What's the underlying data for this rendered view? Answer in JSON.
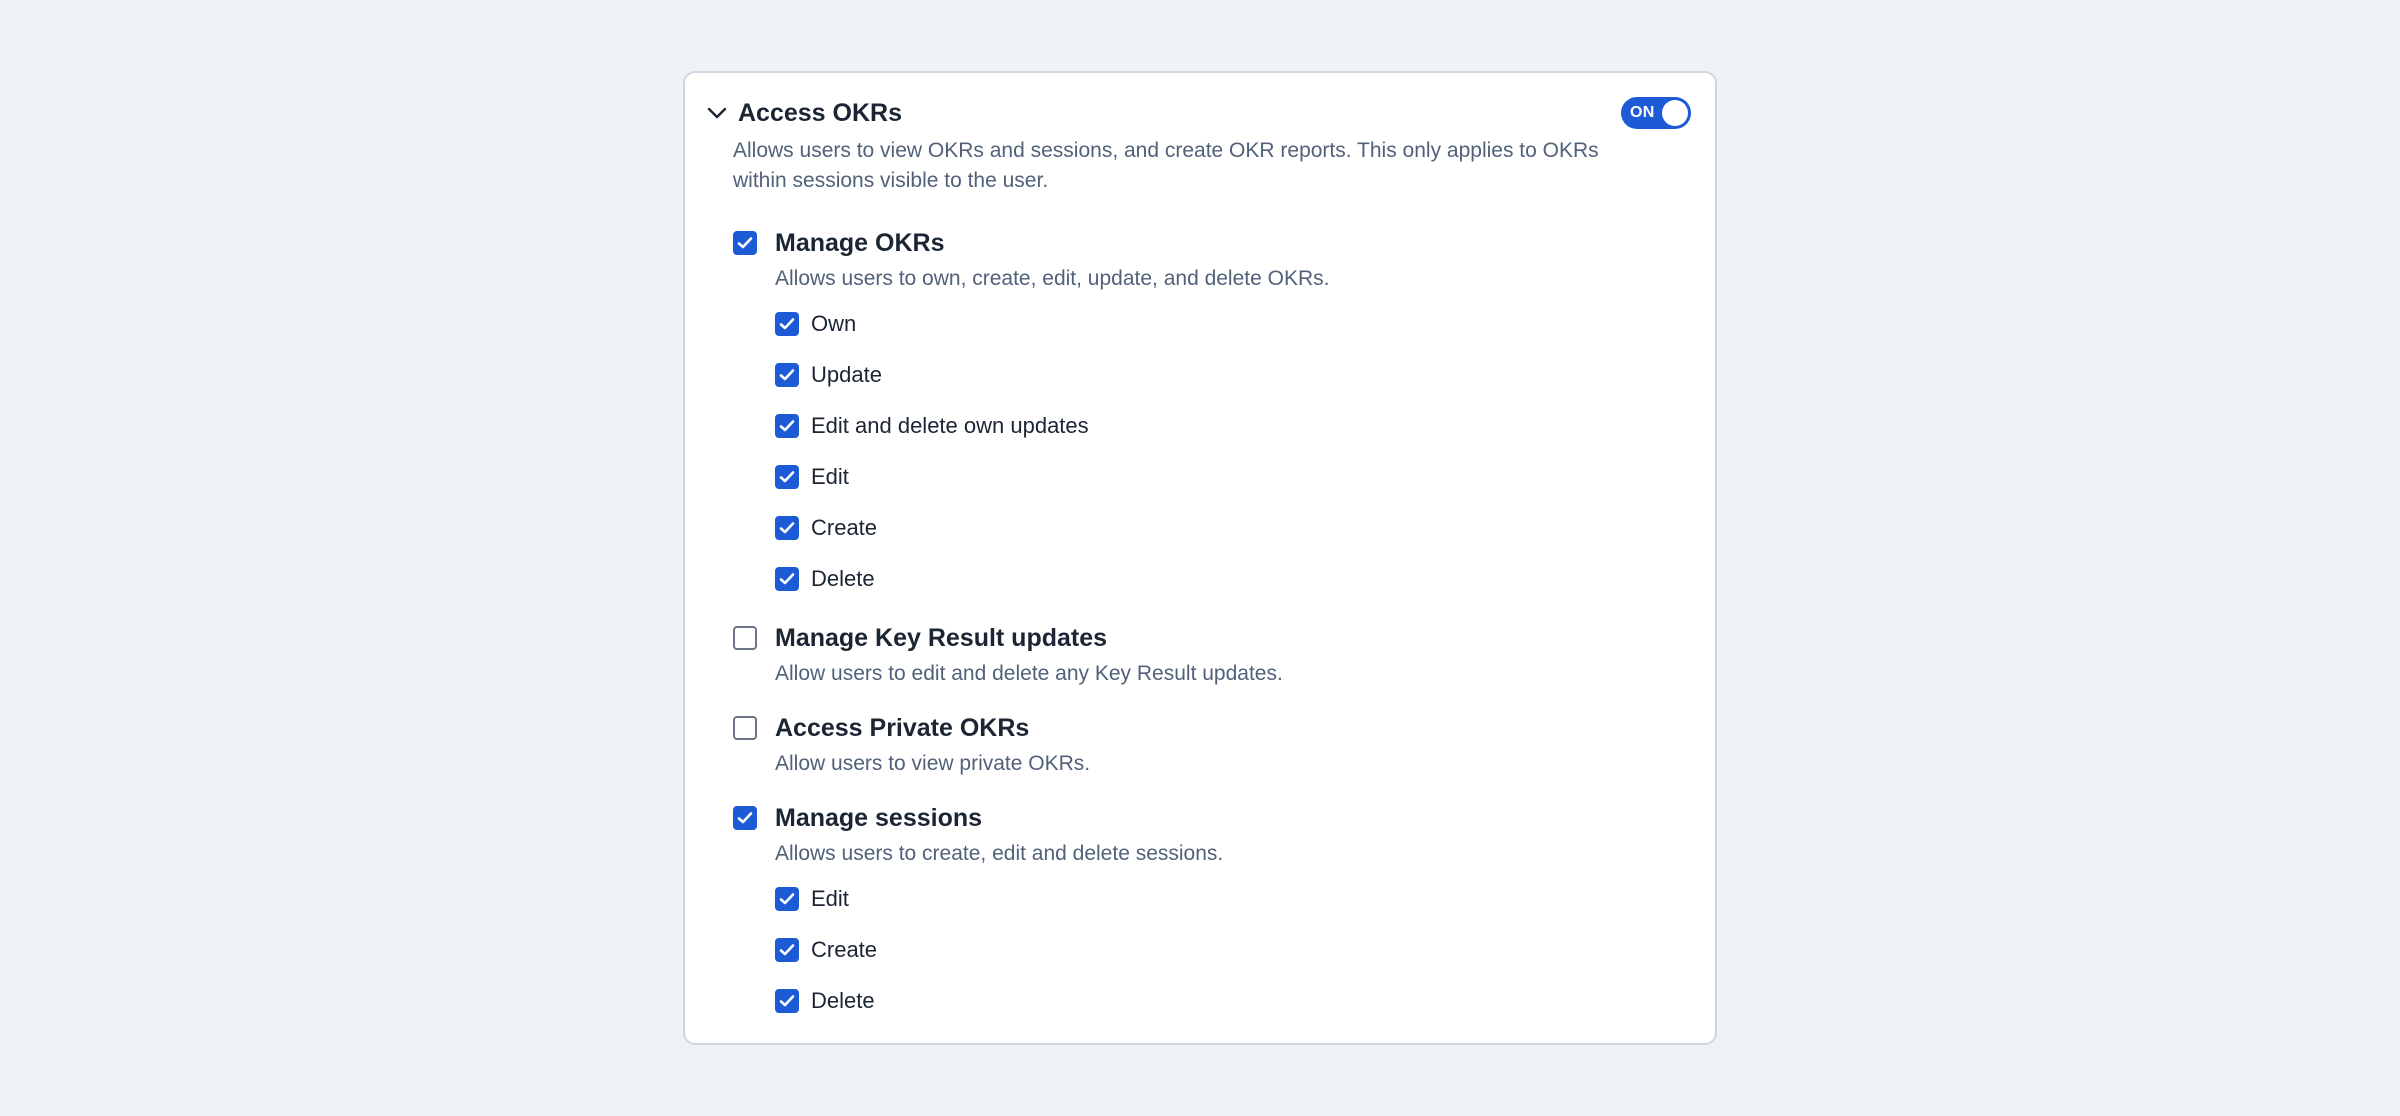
{
  "section": {
    "title": "Access OKRs",
    "toggle_label": "ON",
    "toggle_on": true,
    "description": "Allows users to view OKRs and sessions, and create OKR reports. This only applies to OKRs within sessions visible to the user."
  },
  "groups": [
    {
      "label": "Manage OKRs",
      "checked": true,
      "description": "Allows users to own, create, edit, update, and delete OKRs.",
      "items": [
        {
          "label": "Own",
          "checked": true
        },
        {
          "label": "Update",
          "checked": true
        },
        {
          "label": "Edit and delete own updates",
          "checked": true
        },
        {
          "label": "Edit",
          "checked": true
        },
        {
          "label": "Create",
          "checked": true
        },
        {
          "label": "Delete",
          "checked": true
        }
      ]
    },
    {
      "label": "Manage Key Result updates",
      "checked": false,
      "description": "Allow users to edit and delete any Key Result updates."
    },
    {
      "label": "Access Private OKRs",
      "checked": false,
      "description": "Allow users to view private OKRs."
    },
    {
      "label": "Manage sessions",
      "checked": true,
      "description": "Allows users to create, edit and delete sessions.",
      "items": [
        {
          "label": "Edit",
          "checked": true
        },
        {
          "label": "Create",
          "checked": true
        },
        {
          "label": "Delete",
          "checked": true
        }
      ]
    }
  ],
  "colors": {
    "accent": "#1d5bd6",
    "background": "#f0f3f6",
    "text": "#1b2533",
    "muted_text": "#51617a"
  }
}
